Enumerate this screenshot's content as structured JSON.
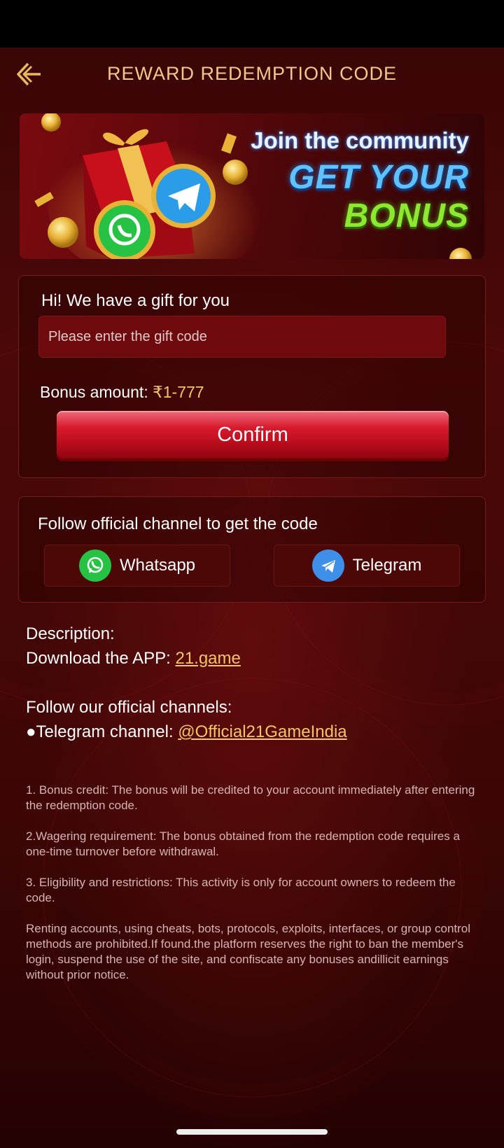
{
  "header": {
    "title": "REWARD REDEMPTION CODE"
  },
  "banner": {
    "line1": "Join the community",
    "line2": "GET YOUR",
    "line3": "BONUS"
  },
  "gift": {
    "heading": "Hi! We have a gift for you",
    "input_placeholder": "Please enter the gift code",
    "input_value": "",
    "bonus_label": "Bonus amount: ",
    "bonus_value": "₹1-777",
    "confirm_label": "Confirm"
  },
  "follow": {
    "heading": "Follow official channel to get the code",
    "whatsapp_label": "Whatsapp",
    "telegram_label": "Telegram"
  },
  "description": {
    "title": "Description:",
    "download_label": "Download the APP: ",
    "download_link": "21.game",
    "channels_title": "Follow our official channels:",
    "telegram_bullet": "●",
    "telegram_label": "Telegram channel: ",
    "telegram_link": "@Official21GameIndia"
  },
  "terms": [
    "1. Bonus credit: The bonus will be credited to your account immediately after entering the redemption code.",
    "2.Wagering requirement: The bonus obtained from the redemption code requires a one-time turnover before withdrawal.",
    "3. Eligibility and restrictions: This activity is only for account owners to redeem the code.",
    "Renting accounts, using cheats, bots, protocols, exploits, interfaces, or group control methods are prohibited.If found.the platform reserves the right to ban the member's login, suspend the use of the site, and confiscate any bonuses andillicit earnings without prior notice."
  ],
  "icons": {
    "back": "back-arrow-icon",
    "whatsapp": "whatsapp-icon",
    "telegram": "telegram-icon",
    "gift": "gift-box-icon",
    "coin": "coin-icon"
  },
  "colors": {
    "accent_gold": "#f3c46a",
    "title_gold": "#f0c98a",
    "confirm_red": "#d81a2e",
    "whatsapp_green": "#25c244",
    "telegram_blue": "#3d8fe8",
    "background": "#4b0808"
  }
}
